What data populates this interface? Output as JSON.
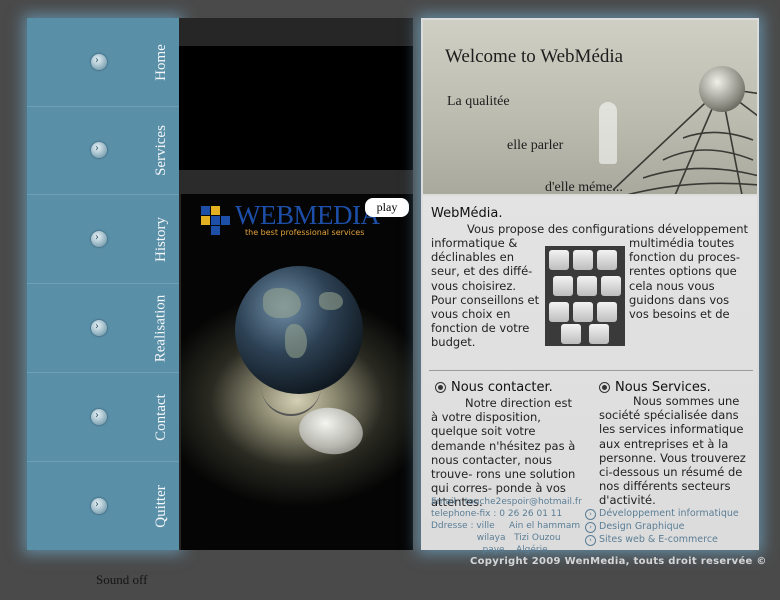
{
  "nav": {
    "items": [
      {
        "label": "Home"
      },
      {
        "label": "Services"
      },
      {
        "label": "History"
      },
      {
        "label": "Realisation"
      },
      {
        "label": "Contact"
      },
      {
        "label": "Quitter"
      }
    ]
  },
  "promo": {
    "logo_text": "WEBMEDIA",
    "logo_tagline": "the best professional services",
    "play_label": "play"
  },
  "banner": {
    "title": "Welcome to WebMédia",
    "line1": "La qualitée",
    "line2": "elle parler",
    "line3": "d'elle méme..."
  },
  "webmedia": {
    "title": "WebMédia.",
    "intro": "Vous propose des configurations développement",
    "col1": "informatique & déclinables en seur, et des diffé- vous choisirez. Pour conseillons et vous choix en fonction de votre budget.",
    "col2": "multimédia toutes fonction du proces- rentes options que cela nous vous guidons dans vos vos besoins et de"
  },
  "contact": {
    "title": "Nous contacter.",
    "body": "Notre direction est à votre disposition, quelque soit votre demande n'hésitez pas à nous contacter, nous trouve- rons une solution qui corres- ponde à vos attentes.",
    "info": "Email : touche2espoir@hotmail.fr\ntelephone-fix : 0 26 26 01 11\nDdresse : ville     Ain el hammam\n                wilaya   Tizi Ouzou\n                  paye    Algérie"
  },
  "services": {
    "title": "Nous Services.",
    "body": "Nous sommes une société spécialisée dans les services informatique aux entreprises et à la personne. Vous trouverez ci-dessous un résumé de nos différents secteurs d'activité.",
    "links": [
      "Développement informatique",
      "Design Graphique",
      "Sites web & E-commerce"
    ]
  },
  "footer": {
    "copyright": "Copyright 2009 WenMedia, touts droit reservée ©",
    "sound": "Sound off"
  },
  "colors": {
    "nav_bg": "#5a8fa8",
    "glow": "#78bee6",
    "page_bg": "#4a4a4a",
    "link": "#5b7e96",
    "logo_blue": "#1d4fa8",
    "logo_orange": "#e2a23a"
  }
}
